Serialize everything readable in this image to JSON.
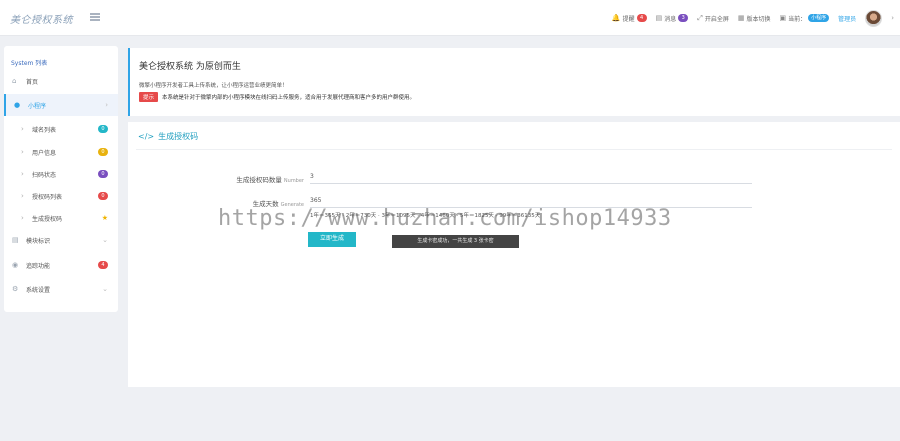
{
  "topbar": {
    "logo": "美仑授权系统",
    "nav": [
      {
        "icon": "bell-icon",
        "glyph": "🔔",
        "label": "提醒",
        "badge": "4",
        "badge_color": "#e64a4a"
      },
      {
        "icon": "message-icon",
        "glyph": "▤",
        "label": "消息",
        "badge": "3",
        "badge_color": "#7a4fbf"
      },
      {
        "icon": "fullscreen-icon",
        "glyph": "⤢",
        "label": "开启全屏"
      },
      {
        "icon": "layout-icon",
        "glyph": "▦",
        "label": "版本切换"
      },
      {
        "icon": "terminal-icon",
        "glyph": "▣",
        "label": "当前：",
        "badge": "小程序",
        "badge_color": "#2fa4e7"
      }
    ],
    "user": "管理员"
  },
  "sidebar": {
    "title": "System 列表",
    "items": [
      {
        "label": "首页",
        "icon": "home-icon"
      },
      {
        "label": "小程序",
        "icon": "wechat-icon"
      },
      {
        "label": "模块标识",
        "icon": "module-icon"
      },
      {
        "label": "追踪功能",
        "icon": "track-icon",
        "badge": "4"
      },
      {
        "label": "系统设置",
        "icon": "settings-icon"
      }
    ],
    "subitems": [
      {
        "label": "域名列表",
        "badge": "0"
      },
      {
        "label": "用户信息",
        "badge": "0"
      },
      {
        "label": "扫码状态",
        "badge": "0"
      },
      {
        "label": "授权码列表",
        "badge": "0"
      },
      {
        "label": "生成授权码"
      }
    ]
  },
  "intro": {
    "title": "美仑授权系统 为原创而生",
    "desc": "微擎小程序开发者工具上传系统，让小程序运营业绩更简单！",
    "tip_badge": "提示",
    "tip_text": "本系统是针对于微擎内部的小程序模块在线扫码上传服务，适合用于发展代理商和客户多的用户群使用。"
  },
  "form": {
    "heading": "生成授权码",
    "count_label": "生成授权码数量",
    "count_sub": "Number",
    "count_value": "3",
    "days_label": "生成天数",
    "days_sub": "Generate",
    "days_value": "365",
    "options": "1年＝365天 · 2年＝730天 · 3年＝1095天 · 4年＝1460天 · 5年＝1825天 · 99年＝36135天",
    "button": "立即生成",
    "toast": "生成卡密成功，一共生成 3 张卡密"
  },
  "watermark": "https://www.huzhan.com/ishop14933"
}
